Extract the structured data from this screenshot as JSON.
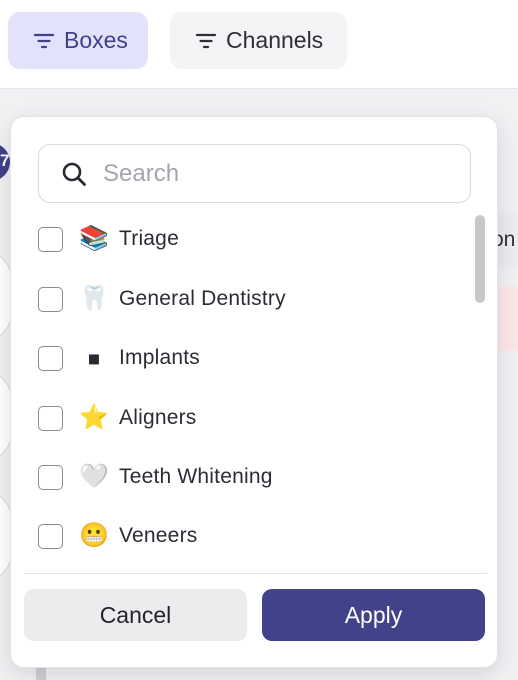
{
  "toolbar": {
    "boxes_label": "Boxes",
    "channels_label": "Channels",
    "filter_icon": "filter-lines-icon"
  },
  "background": {
    "header_cell_text": "on",
    "badge_glyph": "7"
  },
  "dropdown": {
    "search": {
      "placeholder": "Search",
      "value": "",
      "icon": "search-icon"
    },
    "items": [
      {
        "emoji": "📚",
        "label": "Triage",
        "checked": false
      },
      {
        "emoji": "🦷",
        "label": "General Dentistry",
        "checked": false
      },
      {
        "emoji": "◾",
        "label": "Implants",
        "checked": false
      },
      {
        "emoji": "⭐",
        "label": "Aligners",
        "checked": false
      },
      {
        "emoji": "🤍",
        "label": "Teeth Whitening",
        "checked": false
      },
      {
        "emoji": "😬",
        "label": "Veneers",
        "checked": false
      }
    ],
    "cancel_label": "Cancel",
    "apply_label": "Apply"
  },
  "colors": {
    "accent": "#40428a",
    "accent_soft": "#e2e3fb",
    "neutral_button": "#ececef"
  }
}
